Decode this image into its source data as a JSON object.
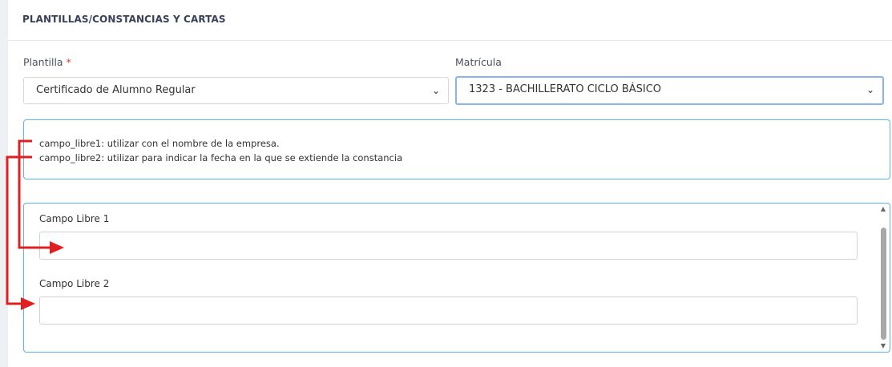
{
  "header": {
    "title": "PLANTILLAS/CONSTANCIAS Y CARTAS"
  },
  "form": {
    "plantilla": {
      "label": "Plantilla",
      "required_mark": "*",
      "value": "Certificado de Alumno Regular"
    },
    "matricula": {
      "label": "Matrícula",
      "value": "1323 - BACHILLERATO CICLO BÁSICO"
    }
  },
  "info": {
    "lines": [
      "campo_libre1: utilizar con el nombre de la empresa.",
      "campo_libre2: utilizar para indicar la fecha en la que se extiende la constancia"
    ]
  },
  "fields": [
    {
      "label": "Campo Libre 1",
      "value": ""
    },
    {
      "label": "Campo Libre 2",
      "value": ""
    }
  ],
  "icons": {
    "select_caret": "chevron-down-icon",
    "scroll_up": "scroll-up-icon",
    "scroll_down": "scroll-down-icon"
  },
  "colors": {
    "annotation_arrow": "#e02020",
    "focus_border": "#5ab6e6"
  }
}
